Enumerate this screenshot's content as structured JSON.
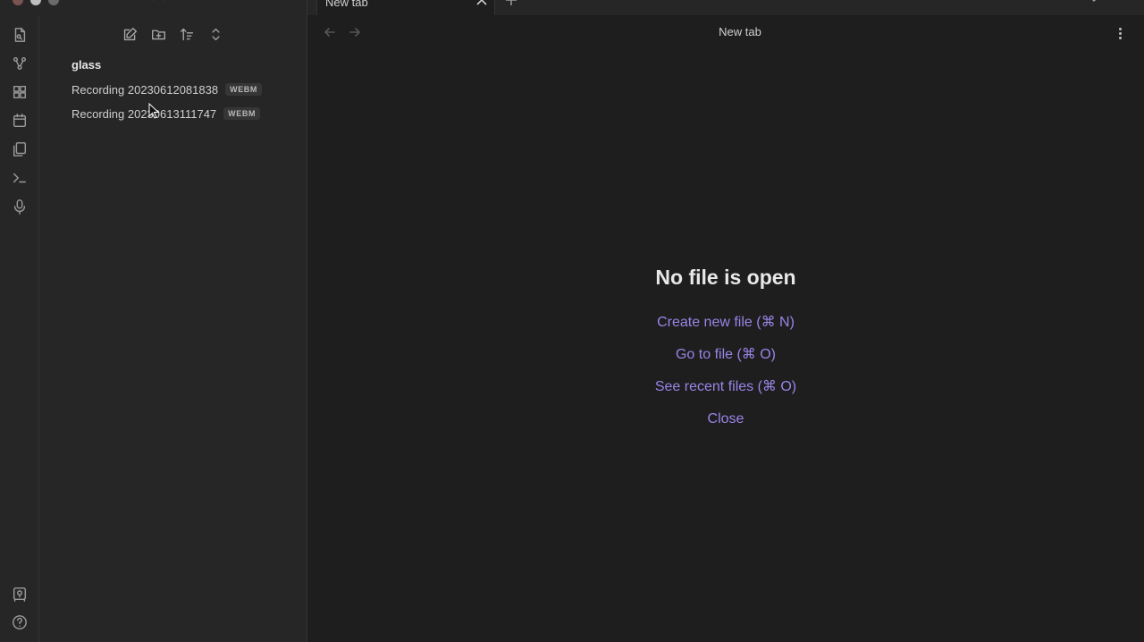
{
  "window": {
    "tab_title": "New tab"
  },
  "ribbon": {
    "items": [
      "switch-file-icon",
      "graph-icon",
      "canvas-icon",
      "calendar-icon",
      "templates-icon",
      "command-palette-icon",
      "microphone-icon"
    ],
    "bottom": [
      "vault-icon",
      "help-icon"
    ]
  },
  "sidebar": {
    "actions": [
      "new-note-icon",
      "new-folder-icon",
      "sort-icon",
      "collapse-icon"
    ],
    "vault_name": "glass",
    "files": [
      {
        "name": "Recording 20230612081838",
        "ext": "WEBM"
      },
      {
        "name": "Recording 20230613111747",
        "ext": "WEBM"
      }
    ]
  },
  "main": {
    "view_title": "New tab",
    "empty_title": "No file is open",
    "actions": [
      "Create new file (⌘ N)",
      "Go to file (⌘ O)",
      "See recent files (⌘ O)",
      "Close"
    ]
  },
  "colors": {
    "accent": "#9b84e8",
    "background": "#1e1e1e",
    "sidebar": "#262626"
  }
}
